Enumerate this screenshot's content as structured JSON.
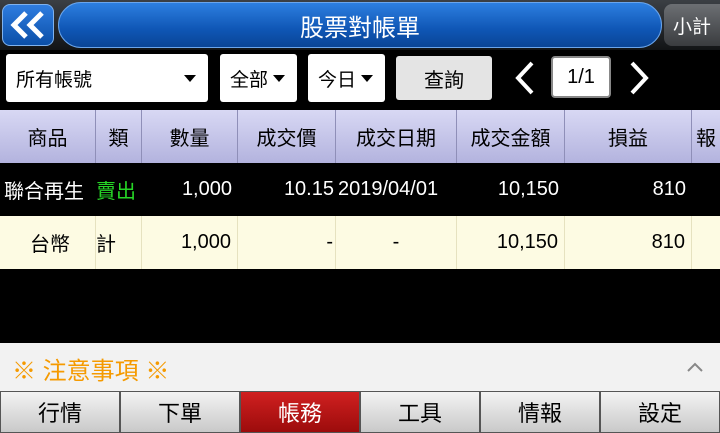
{
  "header": {
    "title": "股票對帳單",
    "subtotal_label": "小計"
  },
  "filters": {
    "account": "所有帳號",
    "type": "全部",
    "period": "今日",
    "query_label": "查詢",
    "page": "1/1"
  },
  "table": {
    "columns": [
      "商品",
      "類",
      "數量",
      "成交價",
      "成交日期",
      "成交金額",
      "損益",
      "報"
    ],
    "rows": [
      {
        "product": "聯合再生",
        "type": "賣出",
        "qty": "1,000",
        "price": "10.15",
        "date": "2019/04/01",
        "amount": "10,150",
        "pnl": "810"
      },
      {
        "product": "台幣",
        "type": "計",
        "qty": "1,000",
        "price": "-",
        "date": "-",
        "amount": "10,150",
        "pnl": "810"
      }
    ]
  },
  "notice": {
    "label": "※ 注意事項 ※"
  },
  "nav": {
    "items": [
      "行情",
      "下單",
      "帳務",
      "工具",
      "情報",
      "設定"
    ],
    "active": "帳務"
  },
  "colors": {
    "accent_blue": "#1763c6",
    "sell_green": "#26d626",
    "notice_orange": "#f59a00",
    "active_tab": "#b81414"
  }
}
